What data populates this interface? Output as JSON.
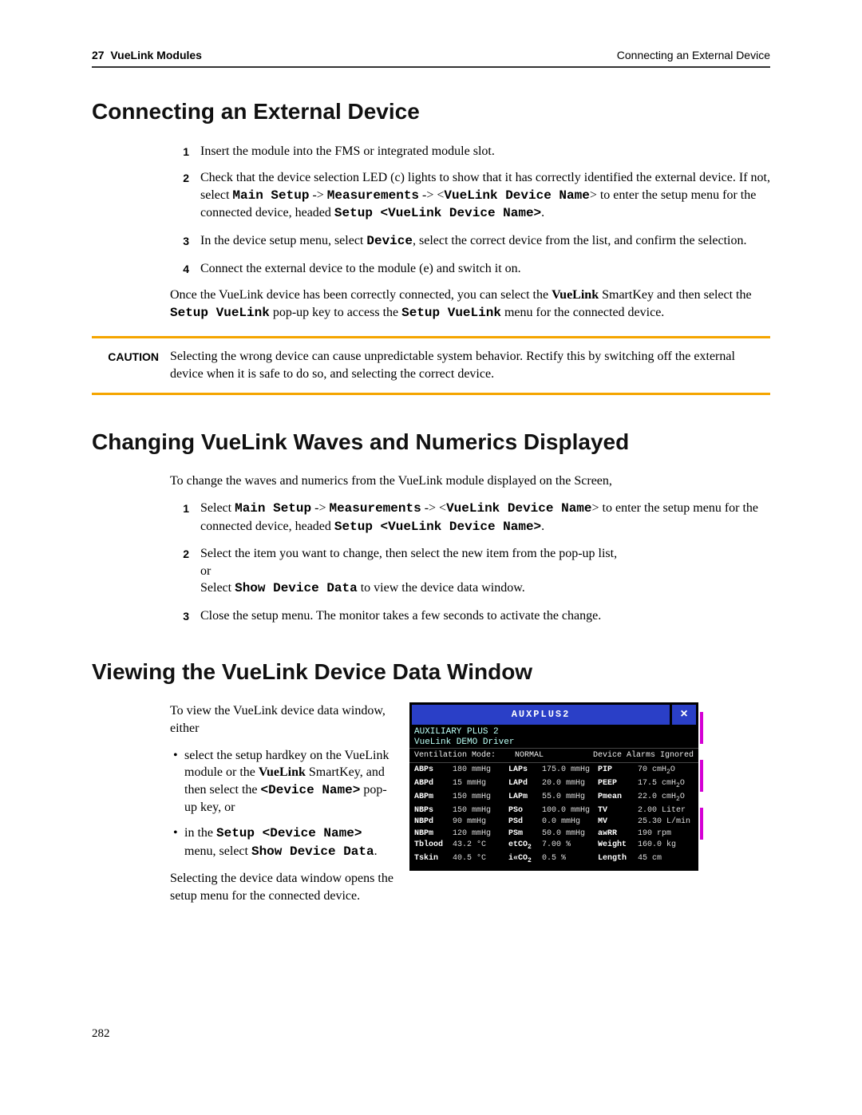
{
  "header": {
    "chapter_num": "27",
    "chapter_title": "VueLink Modules",
    "section_title": "Connecting an External Device"
  },
  "page_number": "282",
  "section1": {
    "title": "Connecting an External Device",
    "steps": [
      "Insert the module into the FMS or integrated module slot.",
      "Check that the device selection LED (c) lights to show that it has correctly identified the external device. If not, select ",
      "In the device setup menu, select ",
      "Connect the external device to the module (e) and switch it on."
    ],
    "step2_tail": " to enter the setup menu for the connected device, headed ",
    "step3_tail": ", select the correct device from the list, and confirm the selection.",
    "m_main_setup": "Main Setup",
    "m_measurements": "Measurements",
    "m_vldn": "VueLink Device Name",
    "m_setup_vldn": "Setup <VueLink Device Name>",
    "m_device": "Device",
    "after_para_pre": "Once the VueLink device has been correctly connected, you can select the ",
    "m_vuelink": "VueLink",
    "after_para_mid": " SmartKey and then select the ",
    "m_setup_vuelink": "Setup VueLink",
    "after_para_mid2": " pop-up key to access the ",
    "after_para_tail": " menu for the connected device."
  },
  "caution": {
    "label": "CAUTION",
    "text": "Selecting the wrong device can cause unpredictable system behavior. Rectify this by switching off the external device when it is safe to do so, and selecting the correct device."
  },
  "section2": {
    "title": "Changing VueLink Waves and Numerics Displayed",
    "intro": "To change the waves and numerics from the VueLink module displayed on the Screen,",
    "step1_pre": "Select ",
    "step1_tail": " to enter the setup menu for the connected device, headed ",
    "step2_a": "Select the item you want to change, then select the new item from the pop-up list,",
    "step2_or": "or",
    "step2_b_pre": "Select ",
    "m_show_device_data": "Show Device Data",
    "step2_b_tail": " to view the device data window.",
    "step3": "Close the setup menu. The monitor takes a few seconds to activate the change."
  },
  "section3": {
    "title": "Viewing the VueLink Device Data Window",
    "intro": "To view the VueLink device data window, either",
    "b1_pre": "select the setup hardkey on the VueLink module or the ",
    "m_vuelink": "VueLink",
    "b1_mid": " SmartKey, and then select the ",
    "m_device_name": "<Device Name>",
    "b1_tail": " pop-up key, or",
    "b2_pre": "in the ",
    "m_setup_device_name": "Setup <Device Name>",
    "b2_mid": " menu, select ",
    "m_show_device_data": "Show Device Data",
    "outro": "Selecting the device data window opens the setup menu for the connected device."
  },
  "device_window": {
    "title": "AUXPLUS2",
    "sub1": "AUXILIARY PLUS 2",
    "sub2": "VueLink DEMO Driver",
    "mode_label": "Ventilation Mode:",
    "mode_value": "NORMAL",
    "alarms": "Device Alarms Ignored",
    "rows": [
      [
        "ABPs",
        "180 mmHg",
        "LAPs",
        "175.0 mmHg",
        "PIP",
        "70 cmH₂O"
      ],
      [
        "ABPd",
        "15 mmHg",
        "LAPd",
        "20.0 mmHg",
        "PEEP",
        "17.5 cmH₂O"
      ],
      [
        "ABPm",
        "150 mmHg",
        "LAPm",
        "55.0 mmHg",
        "Pmean",
        "22.0 cmH₂O"
      ],
      [
        "NBPs",
        "150 mmHg",
        "PSo",
        "100.0 mmHg",
        "TV",
        "2.00 Liter"
      ],
      [
        "NBPd",
        "90 mmHg",
        "PSd",
        "0.0 mmHg",
        "MV",
        "25.30 L/min"
      ],
      [
        "NBPm",
        "120 mmHg",
        "PSm",
        "50.0 mmHg",
        "awRR",
        "190 rpm"
      ],
      [
        "Tblood",
        "43.2 °C",
        "etCO₂",
        "7.00 %",
        "Weight",
        "160.0 kg"
      ],
      [
        "Tskin",
        "40.5 °C",
        "i«CO₂",
        "0.5 %",
        "Length",
        "45 cm"
      ]
    ]
  }
}
